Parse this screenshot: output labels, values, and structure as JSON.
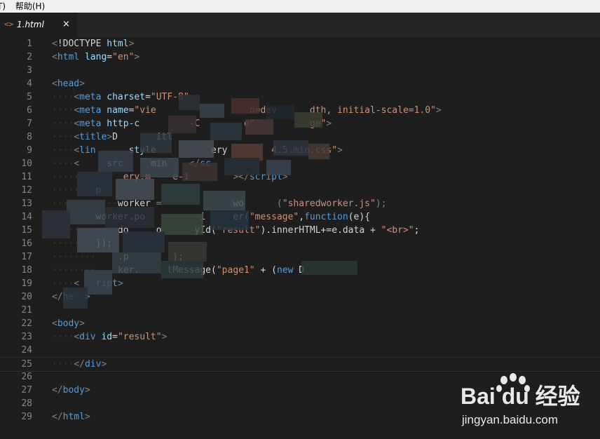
{
  "menubar": {
    "items": [
      "T)",
      "帮助(H)"
    ]
  },
  "tab": {
    "icon": "<>",
    "label": "1.html",
    "close_glyph": "×"
  },
  "editor": {
    "lines": [
      {
        "n": "1",
        "spans": [
          [
            "t-punc",
            "<"
          ],
          [
            "t-text",
            "!DOCTYPE "
          ],
          [
            "t-attr",
            "html"
          ],
          [
            "t-punc",
            ">"
          ]
        ]
      },
      {
        "n": "2",
        "spans": [
          [
            "t-punc",
            "<"
          ],
          [
            "t-tag",
            "html"
          ],
          [
            "t-text",
            " "
          ],
          [
            "t-attr",
            "lang"
          ],
          [
            "t-text",
            "="
          ],
          [
            "t-str",
            "\"en\""
          ],
          [
            "t-punc",
            ">"
          ]
        ]
      },
      {
        "n": "3",
        "spans": []
      },
      {
        "n": "4",
        "spans": [
          [
            "t-punc",
            "<"
          ],
          [
            "t-tag",
            "head"
          ],
          [
            "t-punc",
            ">"
          ]
        ]
      },
      {
        "n": "5",
        "spans": [
          [
            "ws",
            "····"
          ],
          [
            "t-punc",
            "<"
          ],
          [
            "t-tag",
            "meta"
          ],
          [
            "t-text",
            " "
          ],
          [
            "t-attr",
            "charset"
          ],
          [
            "t-text",
            "="
          ],
          [
            "t-str",
            "\"UTF-8\""
          ]
        ]
      },
      {
        "n": "6",
        "spans": [
          [
            "ws",
            "····"
          ],
          [
            "t-punc",
            "<"
          ],
          [
            "t-tag",
            "meta"
          ],
          [
            "t-text",
            " "
          ],
          [
            "t-attr",
            "name"
          ],
          [
            "t-text",
            "="
          ],
          [
            "t-str",
            "\"vie"
          ],
          [
            "t-text",
            "                 "
          ],
          [
            "t-str",
            "n=dev      dth, initial-scale=1.0\""
          ],
          [
            "t-punc",
            ">"
          ]
        ]
      },
      {
        "n": "7",
        "spans": [
          [
            "ws",
            "····"
          ],
          [
            "t-punc",
            "<"
          ],
          [
            "t-tag",
            "meta"
          ],
          [
            "t-text",
            " "
          ],
          [
            "t-attr",
            "http-c"
          ],
          [
            "t-text",
            "         "
          ],
          [
            "t-str",
            "-C        e\""
          ],
          [
            "t-text",
            "          "
          ],
          [
            "t-str",
            "ge\""
          ],
          [
            "t-punc",
            ">"
          ]
        ]
      },
      {
        "n": "8",
        "spans": [
          [
            "ws",
            "····"
          ],
          [
            "t-punc",
            "<"
          ],
          [
            "t-tag",
            "title"
          ],
          [
            "t-punc",
            ">"
          ],
          [
            "t-text",
            "D       itl"
          ]
        ]
      },
      {
        "n": "9",
        "spans": [
          [
            "ws",
            "····"
          ],
          [
            "t-punc",
            "<"
          ],
          [
            "t-tag",
            "lin"
          ],
          [
            "t-text",
            "      "
          ],
          [
            "t-attr",
            "style"
          ],
          [
            "t-text",
            "          "
          ],
          [
            "t-text",
            "ery"
          ],
          [
            "t-text",
            "        "
          ],
          [
            "t-str",
            "4.5.min.css\""
          ],
          [
            "t-punc",
            ">"
          ]
        ]
      },
      {
        "n": "10",
        "spans": [
          [
            "ws",
            "····"
          ],
          [
            "t-punc",
            "<"
          ],
          [
            "t-text",
            "     "
          ],
          [
            "t-attr",
            "src"
          ],
          [
            "t-text",
            "     "
          ],
          [
            "t-text",
            "min"
          ],
          [
            "t-text",
            "    "
          ],
          [
            "t-punc",
            "</"
          ],
          [
            "t-tag",
            "sc"
          ]
        ]
      },
      {
        "n": "11",
        "spans": [
          [
            "ws",
            "········"
          ],
          [
            "t-text",
            "     "
          ],
          [
            "t-str",
            "ery.m"
          ],
          [
            "t-text",
            "    "
          ],
          [
            "t-str",
            "e-1"
          ],
          [
            "t-text",
            "        "
          ],
          [
            "t-punc",
            "></"
          ],
          [
            "t-tag",
            "script"
          ],
          [
            "t-punc",
            ">"
          ]
        ]
      },
      {
        "n": "12",
        "spans": [
          [
            "ws",
            "········"
          ],
          [
            "t-tag",
            "p"
          ]
        ]
      },
      {
        "n": "13",
        "spans": [
          [
            "ws",
            "············"
          ],
          [
            "t-text",
            "worker"
          ],
          [
            "t-text",
            " "
          ],
          [
            "t-punc",
            "="
          ],
          [
            "t-text",
            "             "
          ],
          [
            "t-text",
            "wo"
          ],
          [
            "t-text",
            "      "
          ],
          [
            "t-punc",
            "("
          ],
          [
            "t-str",
            "\"sharedworker.js\""
          ],
          [
            "t-punc",
            ");"
          ]
        ]
      },
      {
        "n": "14",
        "spans": [
          [
            "ws",
            "········"
          ],
          [
            "t-text",
            "worker.po"
          ],
          [
            "t-text",
            "          "
          ],
          [
            "t-text",
            "i"
          ],
          [
            "t-text",
            "     "
          ],
          [
            "t-text",
            "er("
          ],
          [
            "t-str",
            "\"message\""
          ],
          [
            "t-text",
            ","
          ],
          [
            "t-kw",
            "function"
          ],
          [
            "t-text",
            "(e){"
          ]
        ]
      },
      {
        "n": "15",
        "spans": [
          [
            "ws",
            "············"
          ],
          [
            "t-text",
            "do"
          ],
          [
            "t-text",
            "     "
          ],
          [
            "t-text",
            "o"
          ],
          [
            "t-text",
            "      "
          ],
          [
            "t-text",
            "yId("
          ],
          [
            "t-str",
            "\"result\""
          ],
          [
            "t-text",
            ").innerHTML+=e.data + "
          ],
          [
            "t-str",
            "\"<br>\""
          ],
          [
            "t-text",
            ";"
          ]
        ]
      },
      {
        "n": "16",
        "spans": [
          [
            "ws",
            "········"
          ],
          [
            "t-text",
            "});"
          ]
        ]
      },
      {
        "n": "17",
        "spans": [
          [
            "ws",
            "········"
          ],
          [
            "t-text",
            "    "
          ],
          [
            "t-text",
            ".p"
          ],
          [
            "t-text",
            "        "
          ],
          [
            "t-text",
            ");"
          ]
        ]
      },
      {
        "n": "18",
        "spans": [
          [
            "ws",
            "········"
          ],
          [
            "t-text",
            "    "
          ],
          [
            "t-text",
            "ker."
          ],
          [
            "t-text",
            "     "
          ],
          [
            "t-text",
            "tMessage("
          ],
          [
            "t-str",
            "\"page1\""
          ],
          [
            "t-text",
            " + ("
          ],
          [
            "t-kw",
            "new"
          ],
          [
            "t-text",
            " D"
          ]
        ]
      },
      {
        "n": "19",
        "spans": [
          [
            "ws",
            "····"
          ],
          [
            "t-punc",
            "<"
          ],
          [
            "t-text",
            "   "
          ],
          [
            "t-tag",
            "ript"
          ],
          [
            "t-punc",
            ">"
          ]
        ]
      },
      {
        "n": "20",
        "spans": [
          [
            "t-punc",
            "</"
          ],
          [
            "t-tag",
            "he"
          ],
          [
            "t-text",
            "  "
          ],
          [
            "t-punc",
            ">"
          ]
        ]
      },
      {
        "n": "21",
        "spans": []
      },
      {
        "n": "22",
        "spans": [
          [
            "t-punc",
            "<"
          ],
          [
            "t-tag",
            "body"
          ],
          [
            "t-punc",
            ">"
          ]
        ]
      },
      {
        "n": "23",
        "spans": [
          [
            "ws",
            "····"
          ],
          [
            "t-punc",
            "<"
          ],
          [
            "t-tag",
            "div"
          ],
          [
            "t-text",
            " "
          ],
          [
            "t-attr",
            "id"
          ],
          [
            "t-text",
            "="
          ],
          [
            "t-str",
            "\"result\""
          ],
          [
            "t-punc",
            ">"
          ]
        ]
      },
      {
        "n": "24",
        "spans": []
      },
      {
        "n": "25",
        "spans": [
          [
            "ws",
            "····"
          ],
          [
            "t-punc",
            "</"
          ],
          [
            "t-tag",
            "div"
          ],
          [
            "t-punc",
            ">"
          ]
        ]
      },
      {
        "n": "26",
        "spans": []
      },
      {
        "n": "27",
        "spans": [
          [
            "t-punc",
            "</"
          ],
          [
            "t-tag",
            "body"
          ],
          [
            "t-punc",
            ">"
          ]
        ]
      },
      {
        "n": "28",
        "spans": []
      },
      {
        "n": "29",
        "spans": [
          [
            "t-punc",
            "</"
          ],
          [
            "t-tag",
            "html"
          ],
          [
            "t-punc",
            ">"
          ]
        ]
      }
    ]
  },
  "watermark": {
    "logo": "Bai du 经验",
    "url": "jingyan.baidu.com"
  },
  "colors": {
    "background": "#1e1e1e",
    "line_number": "#858585",
    "tag": "#569cd6",
    "attribute": "#9cdcfe",
    "string": "#ce9178",
    "tab_icon": "#e37933"
  }
}
